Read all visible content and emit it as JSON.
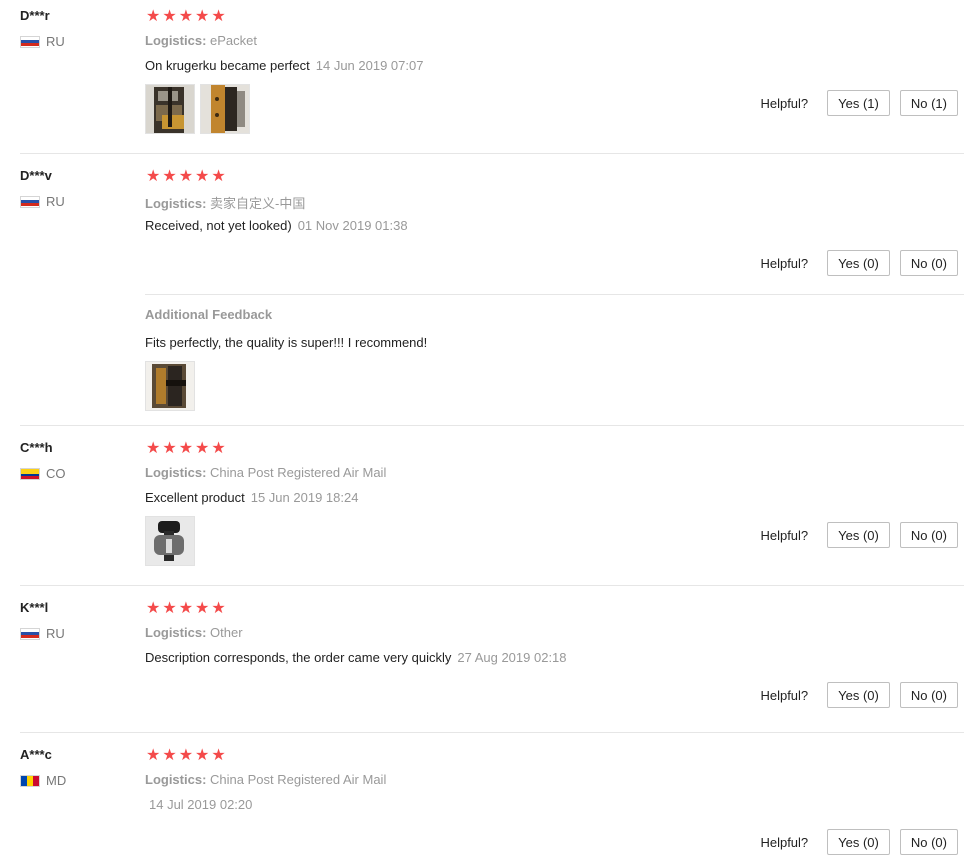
{
  "labels": {
    "logistics": "Logistics:",
    "helpful": "Helpful?",
    "additional_feedback": "Additional Feedback"
  },
  "star_color": "#f44a4a",
  "reviews": [
    {
      "name": "D***r",
      "country": "RU",
      "flag": "russia-flag-icon",
      "rating": 5,
      "logistics": "ePacket",
      "comment": "On krugerku became perfect",
      "date": "14 Jun 2019 07:07",
      "photos": 2,
      "yes": "Yes (1)",
      "no": "No (1)"
    },
    {
      "name": "D***v",
      "country": "RU",
      "flag": "russia-flag-icon",
      "rating": 5,
      "logistics": "卖家自定义-中国",
      "comment": "Received, not yet looked)",
      "date": "01 Nov 2019 01:38",
      "photos": 0,
      "yes": "Yes (0)",
      "no": "No (0)",
      "additional": {
        "comment": "Fits perfectly, the quality is super!!! I recommend!",
        "photos": 1
      }
    },
    {
      "name": "C***h",
      "country": "CO",
      "flag": "colombia-flag-icon",
      "rating": 5,
      "logistics": "China Post Registered Air Mail",
      "comment": "Excellent product",
      "date": "15 Jun 2019 18:24",
      "photos": 1,
      "yes": "Yes (0)",
      "no": "No (0)"
    },
    {
      "name": "K***l",
      "country": "RU",
      "flag": "russia-flag-icon",
      "rating": 5,
      "logistics": "Other",
      "comment": "Description corresponds, the order came very quickly",
      "date": "27 Aug 2019 02:18",
      "photos": 0,
      "yes": "Yes (0)",
      "no": "No (0)"
    },
    {
      "name": "A***c",
      "country": "MD",
      "flag": "moldova-flag-icon",
      "rating": 5,
      "logistics": "China Post Registered Air Mail",
      "comment": "",
      "date": "14 Jul 2019 02:20",
      "photos": 0,
      "yes": "Yes (0)",
      "no": "No (0)"
    }
  ]
}
